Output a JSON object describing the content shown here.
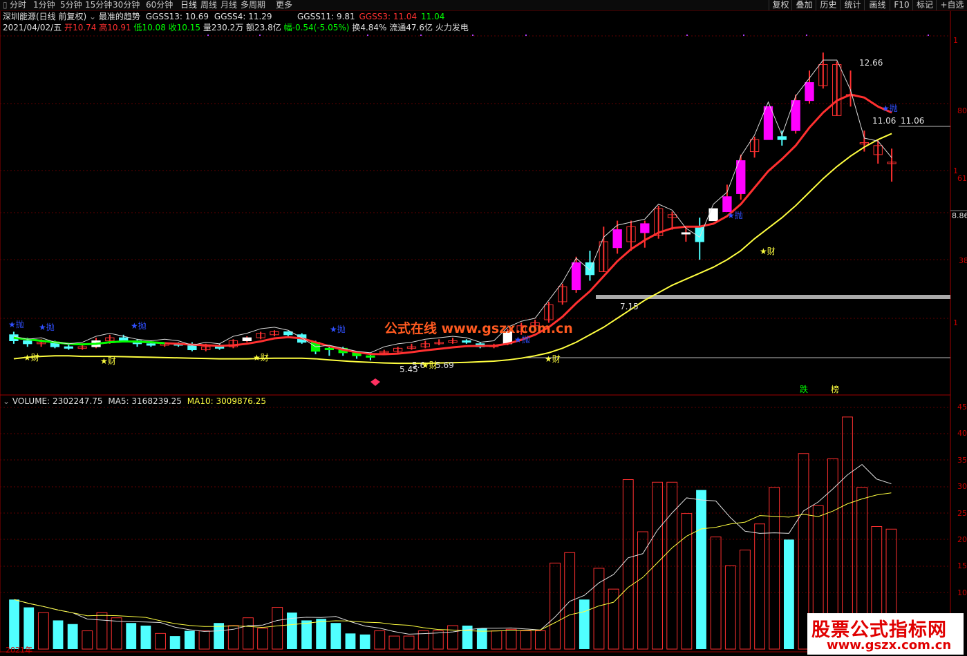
{
  "toolbar": {
    "periods": [
      "分时",
      "1分钟",
      "5分钟",
      "15分钟",
      "30分钟",
      "60分钟",
      "日线",
      "周线",
      "月线",
      "多周期",
      "更多"
    ],
    "active_period": "日线",
    "right_buttons": [
      "复权",
      "叠加",
      "历史",
      "统计",
      "画线",
      "F10",
      "标记",
      "+自选"
    ]
  },
  "header": {
    "stock_name": "深圳能源(日线 前复权)",
    "formula_name": "最准的趋势",
    "gg13": "GGSS13: 10.69",
    "gg4": "GGSS4: 11.29",
    "gg11": "GGSS11: 9.81",
    "gg3_label": "GGSS3: 11.04",
    "gg3_value": "11.04"
  },
  "quote": {
    "date": "2021/04/02/五",
    "open_label": "开",
    "open": "10.74",
    "high_label": "高",
    "high": "10.91",
    "low_label": "低",
    "low": "10.08",
    "close_label": "收",
    "close": "10.15",
    "volume": "量230.2万",
    "amount": "额23.8亿",
    "change": "幅-0.54(-5.05%)",
    "turnover": "换4.84%",
    "float": "流通47.6亿",
    "sector": "火力发电"
  },
  "annotations": {
    "high_price": "12.66",
    "price_a": "11.06",
    "price_b": "11.06",
    "level_715": "7.15",
    "low_545": "5.45",
    "low_569": "5.69",
    "low_568": "5.6",
    "sell_marks": [
      "★抛",
      "★抛",
      "★抛",
      "★抛",
      "★抛",
      "★抛",
      "★抛"
    ],
    "buy_marks": [
      "★财",
      "★财",
      "★财",
      "★财",
      "★财",
      "★财"
    ],
    "top_right_labels": [
      "跌",
      "榜"
    ]
  },
  "axis_right": {
    "price_ticks": [
      "1",
      "80",
      "1",
      "61",
      "8.86",
      "38",
      "1"
    ],
    "volume_ticks": [
      "45",
      "40",
      "35",
      "30",
      "25",
      "20",
      "15",
      "10"
    ]
  },
  "volume": {
    "label": "VOLUME: 2302247.75",
    "ma5": "MA5: 3168239.25",
    "ma10": "MA10: 3009876.25"
  },
  "xaxis": {
    "year_label": "2021年"
  },
  "watermark": {
    "center": "公式在线  www.gszx.com.cn",
    "corner_big": "股票公式指标网",
    "corner_small": "www.gszx.com.cn"
  },
  "colors": {
    "up": "#ff3030",
    "down_fill": "#50ffff",
    "magenta": "#ff00ff",
    "green": "#00ff00",
    "yellow_line": "#ffff40"
  },
  "chart_data": {
    "type": "candlestick",
    "candles": [
      [
        5.5,
        5.6,
        5.2,
        5.3
      ],
      [
        5.3,
        5.4,
        5.1,
        5.2
      ],
      [
        5.2,
        5.35,
        5.1,
        5.25
      ],
      [
        5.25,
        5.3,
        5.05,
        5.1
      ],
      [
        5.1,
        5.2,
        5.0,
        5.05
      ],
      [
        5.05,
        5.15,
        5.0,
        5.1
      ],
      [
        5.1,
        5.4,
        5.05,
        5.3
      ],
      [
        5.3,
        5.5,
        5.2,
        5.4
      ],
      [
        5.4,
        5.5,
        5.25,
        5.3
      ],
      [
        5.3,
        5.35,
        5.1,
        5.2
      ],
      [
        5.2,
        5.3,
        5.1,
        5.15
      ],
      [
        5.15,
        5.25,
        5.1,
        5.2
      ],
      [
        5.2,
        5.25,
        5.1,
        5.15
      ],
      [
        5.15,
        5.25,
        4.95,
        5.0
      ],
      [
        5.0,
        5.2,
        4.95,
        5.1
      ],
      [
        5.1,
        5.2,
        5.0,
        5.05
      ],
      [
        5.1,
        5.35,
        5.05,
        5.3
      ],
      [
        5.3,
        5.45,
        5.25,
        5.4
      ],
      [
        5.4,
        5.6,
        5.35,
        5.55
      ],
      [
        5.5,
        5.65,
        5.45,
        5.6
      ],
      [
        5.6,
        5.62,
        5.45,
        5.5
      ],
      [
        5.5,
        5.55,
        5.2,
        5.25
      ],
      [
        5.25,
        5.3,
        4.85,
        4.95
      ],
      [
        5.05,
        5.1,
        4.8,
        5.0
      ],
      [
        5.05,
        5.1,
        4.8,
        4.9
      ],
      [
        4.9,
        4.95,
        4.7,
        4.8
      ],
      [
        4.8,
        4.85,
        4.65,
        4.75
      ],
      [
        4.9,
        5.0,
        4.85,
        4.95
      ],
      [
        4.95,
        5.1,
        4.9,
        5.05
      ],
      [
        5.05,
        5.2,
        5.0,
        5.1
      ],
      [
        5.1,
        5.3,
        5.05,
        5.2
      ],
      [
        5.2,
        5.35,
        5.15,
        5.25
      ],
      [
        5.25,
        5.4,
        5.2,
        5.3
      ],
      [
        5.3,
        5.35,
        5.2,
        5.25
      ],
      [
        5.2,
        5.25,
        5.05,
        5.1
      ],
      [
        5.1,
        5.2,
        5.05,
        5.15
      ],
      [
        5.2,
        5.7,
        5.15,
        5.6
      ],
      [
        5.6,
        5.9,
        5.5,
        5.8
      ],
      [
        5.8,
        6.0,
        5.7,
        5.9
      ],
      [
        6.0,
        6.6,
        5.9,
        6.5
      ],
      [
        6.6,
        7.2,
        6.5,
        7.1
      ],
      [
        7.0,
        8.1,
        6.9,
        7.9
      ],
      [
        7.9,
        8.3,
        7.3,
        7.5
      ],
      [
        7.6,
        9.1,
        7.6,
        8.6
      ],
      [
        8.4,
        9.3,
        8.2,
        9.0
      ],
      [
        8.6,
        9.3,
        8.3,
        9.1
      ],
      [
        8.9,
        9.3,
        8.4,
        9.2
      ],
      [
        8.8,
        9.8,
        8.7,
        9.7
      ],
      [
        9.4,
        9.6,
        9.0,
        9.5
      ],
      [
        8.9,
        9.1,
        8.6,
        8.9
      ],
      [
        9.1,
        9.4,
        8.0,
        8.6
      ],
      [
        9.3,
        9.7,
        9.3,
        9.7
      ],
      [
        9.6,
        10.5,
        9.6,
        10.1
      ],
      [
        10.2,
        11.5,
        10.0,
        11.3
      ],
      [
        11.6,
        12.1,
        11.4,
        12.0
      ],
      [
        12.0,
        13.1,
        12.0,
        13.1
      ],
      [
        12.1,
        12.3,
        11.8,
        12.0
      ],
      [
        12.3,
        13.5,
        12.2,
        13.3
      ],
      [
        13.3,
        14.3,
        13.2,
        13.9
      ],
      [
        13.8,
        14.9,
        13.7,
        14.5
      ],
      [
        12.8,
        14.6,
        12.8,
        14.5
      ],
      [
        13.5,
        14.3,
        13.1,
        13.5
      ],
      [
        11.9,
        12.3,
        11.6,
        11.9
      ],
      [
        11.5,
        12.0,
        11.2,
        11.8
      ],
      [
        11.2,
        11.7,
        10.6,
        11.25
      ]
    ],
    "ma_red": [
      5.4,
      5.35,
      5.3,
      5.25,
      5.2,
      5.18,
      5.2,
      5.25,
      5.28,
      5.27,
      5.25,
      5.22,
      5.2,
      5.17,
      5.15,
      5.13,
      5.15,
      5.2,
      5.28,
      5.38,
      5.42,
      5.38,
      5.25,
      5.12,
      5.0,
      4.92,
      4.86,
      4.85,
      4.87,
      4.92,
      4.98,
      5.03,
      5.08,
      5.12,
      5.13,
      5.13,
      5.2,
      5.33,
      5.5,
      5.75,
      6.1,
      6.55,
      6.95,
      7.45,
      7.95,
      8.35,
      8.65,
      8.9,
      9.05,
      9.1,
      9.1,
      9.2,
      9.45,
      9.85,
      10.4,
      10.95,
      11.35,
      11.8,
      12.4,
      12.9,
      13.3,
      13.5,
      13.4,
      13.1,
      12.9
    ],
    "ma_yellow": [
      4.7,
      4.75,
      4.78,
      4.8,
      4.8,
      4.78,
      4.78,
      4.78,
      4.77,
      4.76,
      4.75,
      4.74,
      4.73,
      4.72,
      4.71,
      4.7,
      4.7,
      4.7,
      4.71,
      4.72,
      4.72,
      4.72,
      4.7,
      4.66,
      4.63,
      4.6,
      4.58,
      4.56,
      4.55,
      4.55,
      4.55,
      4.56,
      4.57,
      4.58,
      4.6,
      4.62,
      4.66,
      4.72,
      4.8,
      4.9,
      5.05,
      5.25,
      5.5,
      5.75,
      6.05,
      6.35,
      6.65,
      6.9,
      7.15,
      7.35,
      7.55,
      7.75,
      8.0,
      8.3,
      8.7,
      9.05,
      9.4,
      9.8,
      10.25,
      10.7,
      11.1,
      11.45,
      11.75,
      12.0,
      12.2
    ],
    "volume_values": [
      9.5,
      8.0,
      7.0,
      5.5,
      4.8,
      3.5,
      7.0,
      6.0,
      5.0,
      4.5,
      3.0,
      2.5,
      3.5,
      3.5,
      5.0,
      4.5,
      6.0,
      4.0,
      8.0,
      7.0,
      5.5,
      5.8,
      5.0,
      3.0,
      2.8,
      3.5,
      2.5,
      2.5,
      3.5,
      3.5,
      4.5,
      4.5,
      4.0,
      3.5,
      3.8,
      3.5,
      3.5,
      16.5,
      18.5,
      9.5,
      15.5,
      11.5,
      32.5,
      22.5,
      32.0,
      32.0,
      26.0,
      30.5,
      21.5,
      16.0,
      19.0,
      24.0,
      31.0,
      21.0,
      37.5,
      27.5,
      36.5,
      44.5,
      31.0,
      23.5,
      23.0
    ],
    "ylim_price": [
      4.0,
      15.5
    ],
    "ylim_volume": [
      0,
      47
    ]
  }
}
